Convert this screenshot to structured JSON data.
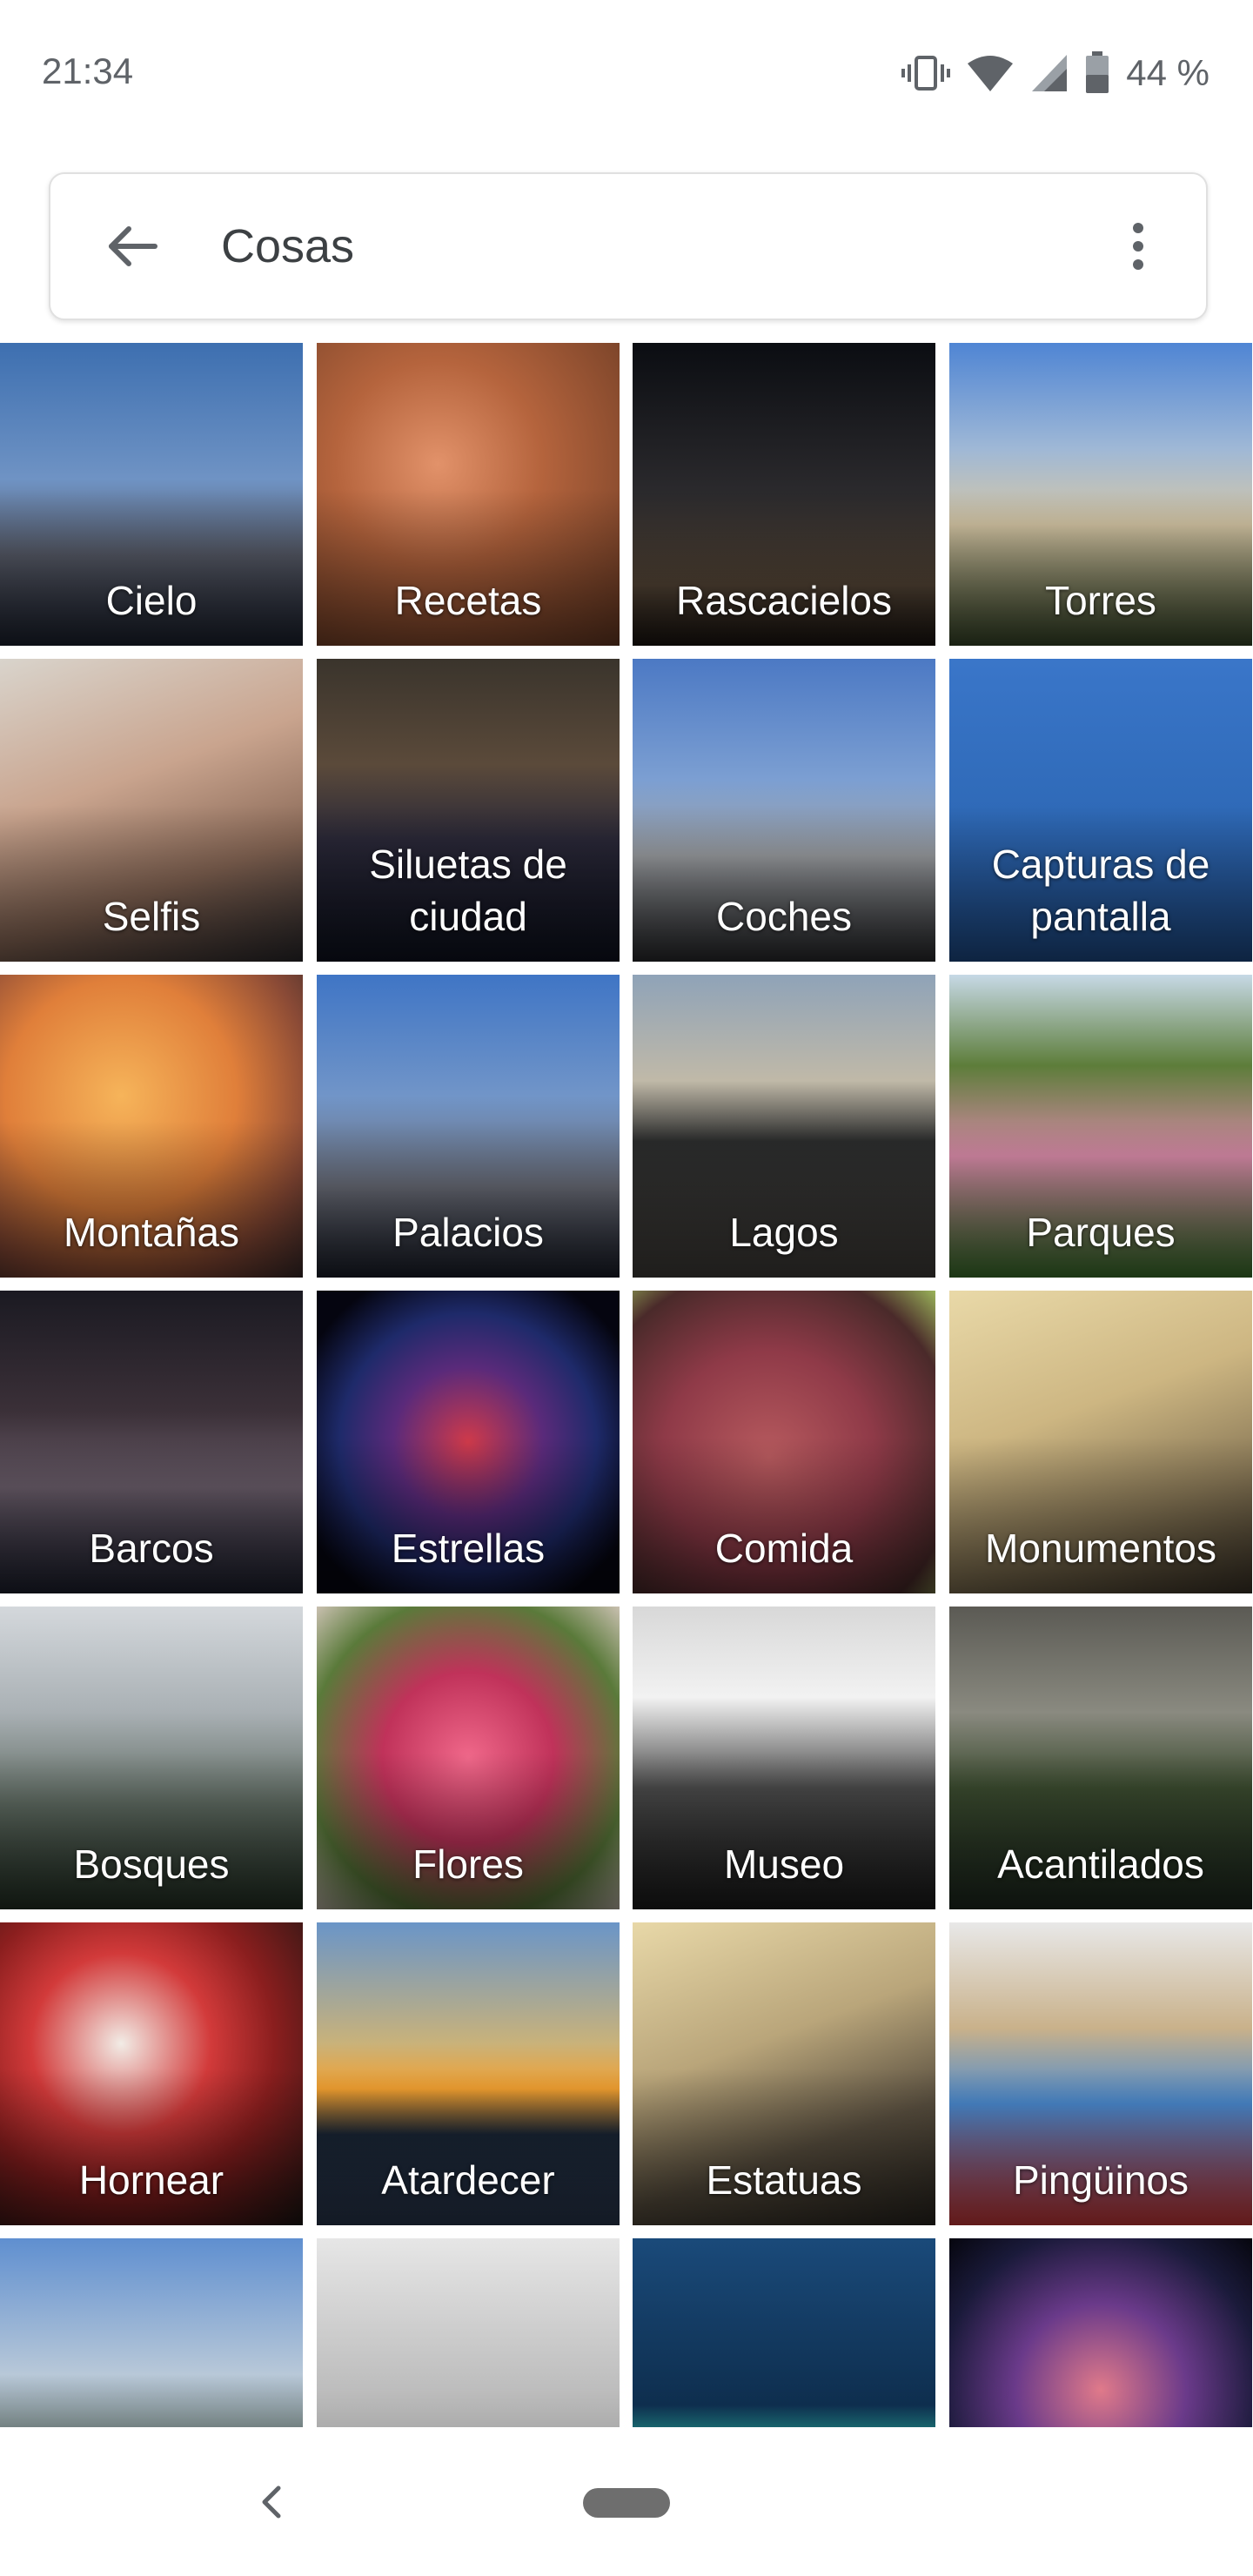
{
  "status_bar": {
    "time": "21:34",
    "battery": "44 %"
  },
  "search": {
    "query": "Cosas"
  },
  "icons": {
    "back": "arrow-back-icon",
    "more": "more-vert-icon",
    "vibrate": "vibrate-icon",
    "wifi": "wifi-icon",
    "signal": "cell-signal-icon",
    "battery": "battery-icon",
    "nav_back": "nav-back-icon"
  },
  "colors": {
    "text_gray": "#5f6368",
    "nav_pill": "#6e6e6e"
  },
  "tiles": [
    {
      "label": "Cielo",
      "bg": "linear-gradient(180deg,#3d6fb0 0%,#6f93c4 45%,#5a5e6b 70%,#1d2331 100%)"
    },
    {
      "label": "Recetas",
      "bg": "radial-gradient(circle at 40% 40%,#e2926a 0%,#b5643d 40%,#6b3b24 100%)"
    },
    {
      "label": "Rascacielos",
      "bg": "linear-gradient(180deg,#0b0d12 0%,#2b2a2d 50%,#5a4a3a 80%,#1a1410 100%)"
    },
    {
      "label": "Torres",
      "bg": "linear-gradient(180deg,#4f85d4 0%,#9fb8d6 35%,#d7c8a6 60%,#3a4a2a 100%)"
    },
    {
      "label": "Selfis",
      "bg": "linear-gradient(160deg,#d9d4cc 0%,#c9a48e 40%,#8b6a58 70%,#2c2a2d 100%)"
    },
    {
      "label": "Siluetas de ciudad",
      "bg": "linear-gradient(180deg,#3a342c 0%,#5b4a3a 35%,#2a2838 60%,#0e1220 100%)"
    },
    {
      "label": "Coches",
      "bg": "linear-gradient(180deg,#4c79c4 0%,#7c9fd2 40%,#9fa2a6 65%,#2a2b2e 100%)"
    },
    {
      "label": "Capturas de pantalla",
      "bg": "linear-gradient(180deg,#3a76c9 0%,#2f6ab8 50%,#1f4f8f 100%)",
      "capture": true
    },
    {
      "label": "Montañas",
      "bg": "radial-gradient(circle at 40% 40%,#f6b45a 0%,#e07f3a 45%,#8a4a36 75%,#3a2a2a 100%)"
    },
    {
      "label": "Palacios",
      "bg": "linear-gradient(180deg,#3f75c5 0%,#7195c8 40%,#6c6f7a 70%,#1b1f2b 100%)"
    },
    {
      "label": "Lagos",
      "bg": "linear-gradient(180deg,#8fa3b8 0%,#c0b9a8 35%,#2b2c2c 55%,#44413d 100%)"
    },
    {
      "label": "Parques",
      "bg": "linear-gradient(180deg,#c7d9e6 0%,#5d7d3a 30%,#d88aa8 60%,#3f7a2f 100%)"
    },
    {
      "label": "Barcos",
      "bg": "linear-gradient(180deg,#1b1a22 0%,#3b3038 40%,#6a5d6a 65%,#1e2130 100%)"
    },
    {
      "label": "Estrellas",
      "bg": "radial-gradient(circle at 50% 50%,#d03a4a 0%,#5a2a7a 35%,#1e2a6a 60%,#050510 85%)"
    },
    {
      "label": "Comida",
      "bg": "radial-gradient(circle at 45% 55%,#b75a5e 0%,#8f3a48 45%,#4a2a2a 80%,#9ab35a 100%)"
    },
    {
      "label": "Monumentos",
      "bg": "linear-gradient(160deg,#e9d9a8 0%,#cdb682 40%,#8b7a58 70%,#3c3428 100%)"
    },
    {
      "label": "Bosques",
      "bg": "linear-gradient(180deg,#d4d8dc 0%,#a9b0b4 35%,#5f6b62 65%,#243225 100%)"
    },
    {
      "label": "Flores",
      "bg": "radial-gradient(circle at 50% 50%,#f0688a 0%,#c0325a 40%,#5a7a3a 75%,#c9c0b0 100%)"
    },
    {
      "label": "Museo",
      "bg": "linear-gradient(180deg,#d8d8d8 0%,#f2f2f2 30%,#4a4a4a 60%,#1c1c1c 100%)"
    },
    {
      "label": "Acantilados",
      "bg": "linear-gradient(180deg,#5b5a54 0%,#8a8a80 35%,#3a4a2e 60%,#1e2a20 100%)"
    },
    {
      "label": "Hornear",
      "bg": "radial-gradient(circle at 40% 40%,#f2ece6 0%,#d23a3a 35%,#8a1e1e 60%,#1a1512 100%)"
    },
    {
      "label": "Atardecer",
      "bg": "linear-gradient(180deg,#6a95c8 0%,#c9b27a 40%,#f2a030 55%,#1a2636 70%,#2c3a52 100%)"
    },
    {
      "label": "Estatuas",
      "bg": "linear-gradient(160deg,#e8d8a8 0%,#b9a57a 40%,#5a5040 70%,#2a2620 100%)"
    },
    {
      "label": "Pingüinos",
      "bg": "linear-gradient(180deg,#e8e8e8 0%,#c9b18a 35%,#4a8ad0 60%,#d83a3a 100%)"
    },
    {
      "label": "",
      "bg": "linear-gradient(180deg,#5f8fd0 0%,#b8c8d8 45%,#2e3a2a 80%,#1a2218 100%)"
    },
    {
      "label": "",
      "bg": "linear-gradient(180deg,#e6e6e6 0%,#bdbdbd 50%,#7a7a7a 100%)"
    },
    {
      "label": "",
      "bg": "linear-gradient(180deg,#1a4a7a 0%,#0e2e4e 55%,#2ac0a0 75%,#2a1a10 100%)"
    },
    {
      "label": "",
      "bg": "radial-gradient(circle at 50% 50%,#e07a8a 0%,#6a3a8a 40%,#1a1a3a 75%,#06060e 100%)"
    }
  ]
}
